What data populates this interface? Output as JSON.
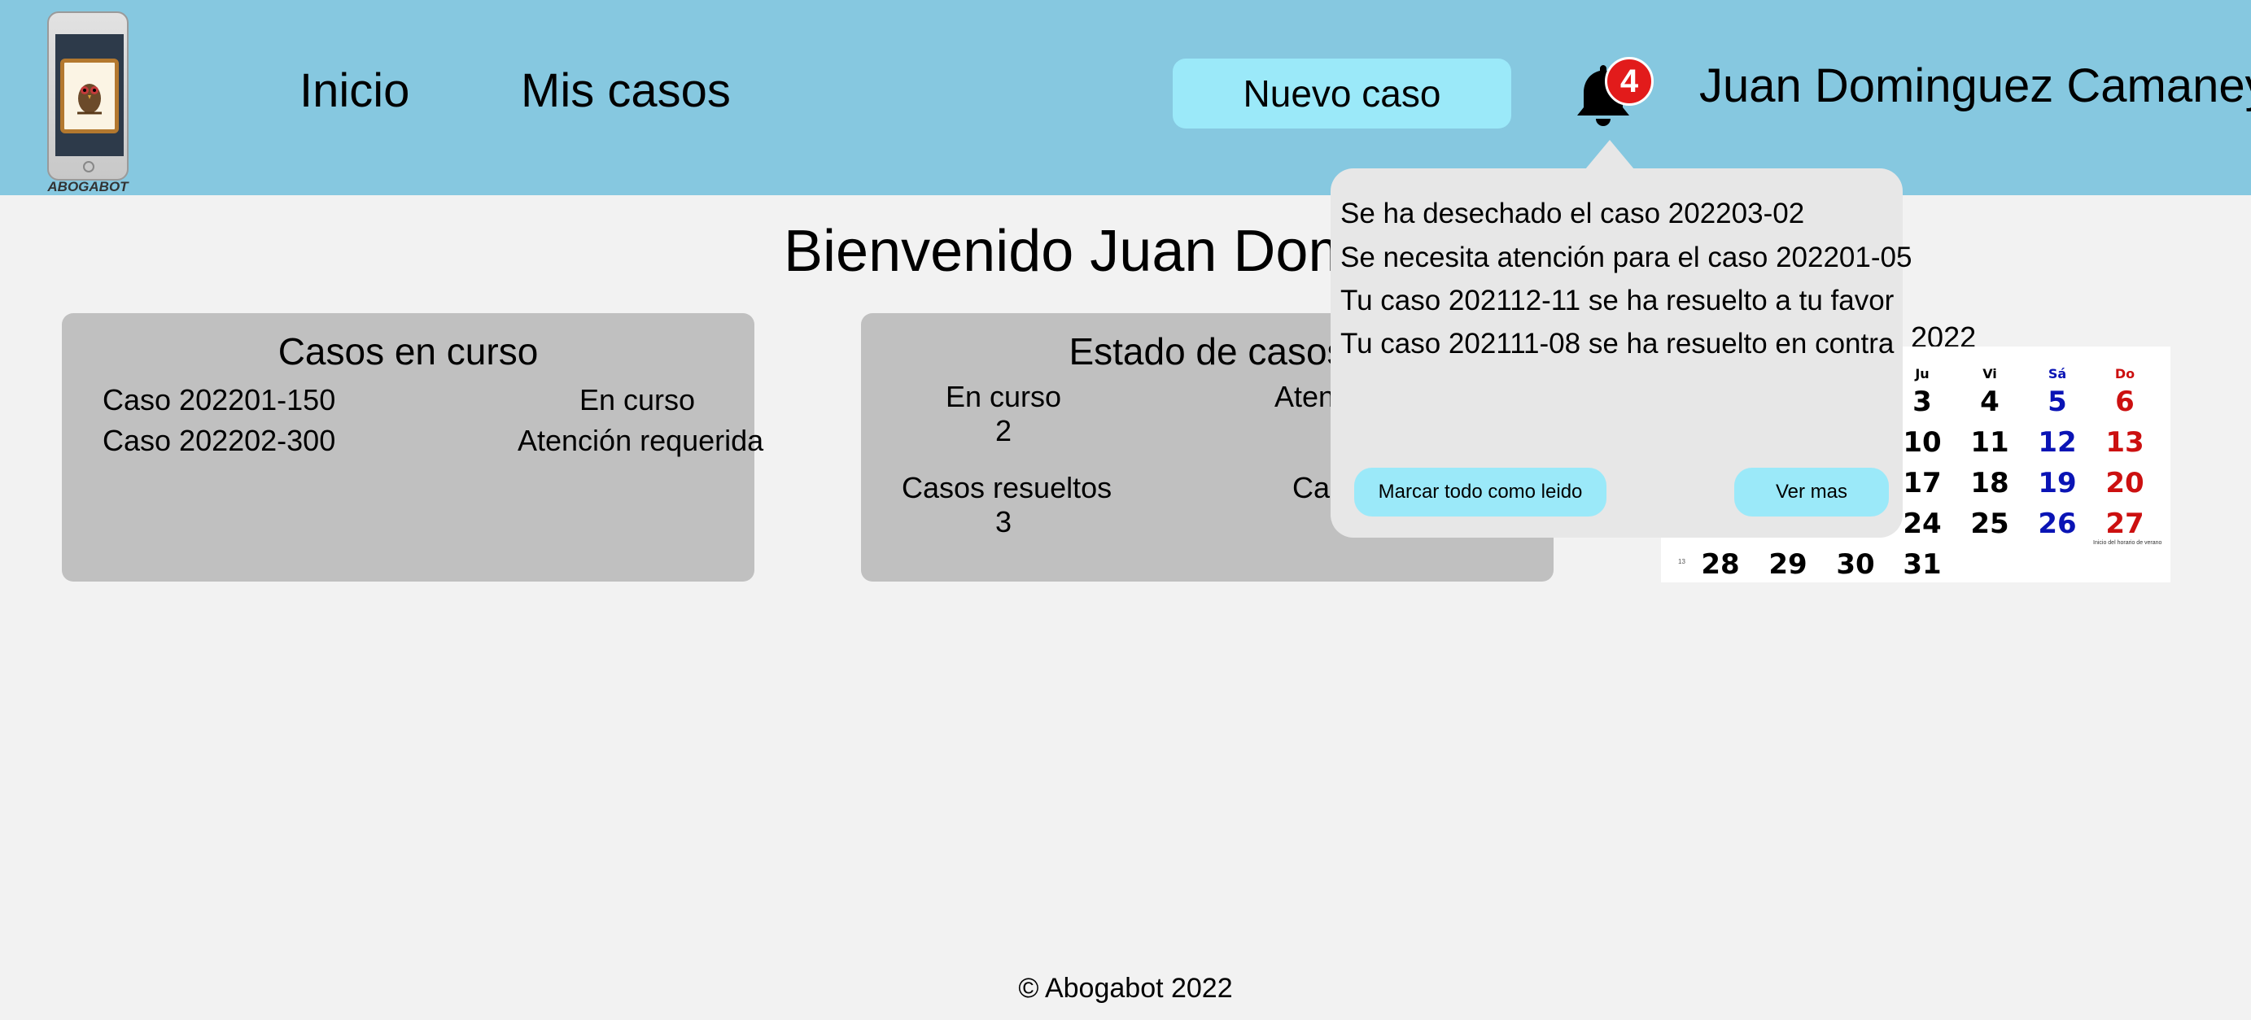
{
  "header": {
    "logo_text": "ABOGABOT",
    "nav": {
      "home": "Inicio",
      "my_cases": "Mis casos"
    },
    "new_case_button": "Nuevo caso",
    "notification_count": "4",
    "user_name": "Juan Dominguez Camaney"
  },
  "welcome": "Bienvenido Juan Doming",
  "cases_card": {
    "title": "Casos en curso",
    "rows": [
      {
        "case": "Caso 202201-150",
        "status": "En curso"
      },
      {
        "case": "Caso 202202-300",
        "status": "Atención requerida"
      }
    ]
  },
  "status_card": {
    "title": "Estado de casos",
    "stats": [
      {
        "label": "En curso",
        "value": "2"
      },
      {
        "label": "Atenc",
        "value": ""
      },
      {
        "label": "Casos resueltos",
        "value": "3"
      },
      {
        "label": "Cas",
        "value": ""
      }
    ]
  },
  "calendar": {
    "title": "zo 2022",
    "headers": [
      "Ju",
      "Vi",
      "Sá",
      "Do"
    ],
    "rows": [
      [
        "3",
        "4",
        "5",
        "6"
      ],
      [
        "10",
        "11",
        "12",
        "13"
      ],
      [
        "17",
        "18",
        "19",
        "20"
      ],
      [
        "24",
        "25",
        "26",
        "27"
      ]
    ],
    "last_row": [
      "28",
      "29",
      "30",
      "31"
    ],
    "note": "Inicio del horario de verano",
    "week_label": "13"
  },
  "notifications": {
    "items": [
      "Se ha desechado el caso 202203-02",
      "Se necesita atención para el caso 202201-05",
      "Tu caso 202112-11 se ha resuelto a tu favor",
      "Tu caso 202111-08 se ha resuelto en contra"
    ],
    "mark_all_label": "Marcar todo como leido",
    "see_more_label": "Ver mas"
  },
  "footer": "© Abogabot 2022",
  "colors": {
    "header_bg": "#86c8e0",
    "button_bg": "#9be9f9",
    "card_bg": "#c0c0c0",
    "popup_bg": "#e7e7e7",
    "badge": "#e21b1b",
    "weekend_saturday": "#0a14b5",
    "weekend_sunday": "#cc1010"
  },
  "icons": {
    "bell": "bell-icon",
    "logo": "phone-owl-logo-icon"
  }
}
